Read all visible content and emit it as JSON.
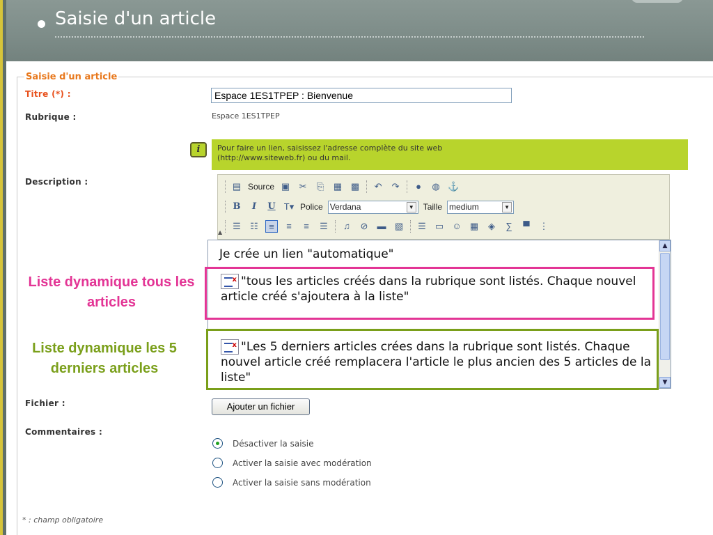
{
  "header": {
    "title": "Saisie d'un article"
  },
  "form": {
    "legend": "Saisie d'un article",
    "titre_label": "Titre (*) :",
    "titre_value": "Espace 1ES1TPEP : Bienvenue",
    "rubrique_label": "Rubrique :",
    "rubrique_value": "Espace 1ES1TPEP",
    "info_line1": "Pour faire un lien, saisissez l'adresse complète du site web",
    "info_line2": "(http://www.siteweb.fr) ou du mail.",
    "description_label": "Description :",
    "fichier_label": "Fichier :",
    "fichier_button": "Ajouter un fichier",
    "commentaires_label": "Commentaires :",
    "footnote": "* : champ obligatoire"
  },
  "toolbar": {
    "source_label": "Source",
    "police_label": "Police",
    "police_value": "Verdana",
    "taille_label": "Taille",
    "taille_value": "medium"
  },
  "editor": {
    "line1": "Je crée un lien \"automatique\"",
    "para2": "\"tous les articles créés dans la rubrique sont listés. Chaque nouvel article créé s'ajoutera à la liste\"",
    "para3": "\"Les 5 derniers articles crées dans la rubrique sont listés. Chaque nouvel article créé remplacera l'article le plus ancien des 5 articles de la liste\""
  },
  "annotations": {
    "pink": "Liste dynamique tous les articles",
    "green": "Liste dynamique les 5 derniers articles",
    "pink_color": "#e33595",
    "green_color": "#7a9f1a"
  },
  "comments": {
    "options": [
      {
        "label": "Désactiver la saisie",
        "checked": true
      },
      {
        "label": "Activer la saisie avec modération",
        "checked": false
      },
      {
        "label": "Activer la saisie sans modération",
        "checked": false
      }
    ]
  },
  "icons": [
    "info-icon",
    "source-icon",
    "cut-icon",
    "copy-icon",
    "paste-icon",
    "undo-icon",
    "redo-icon",
    "link-icon",
    "anchor-icon",
    "list-icon",
    "smiley-icon",
    "table-icon"
  ]
}
